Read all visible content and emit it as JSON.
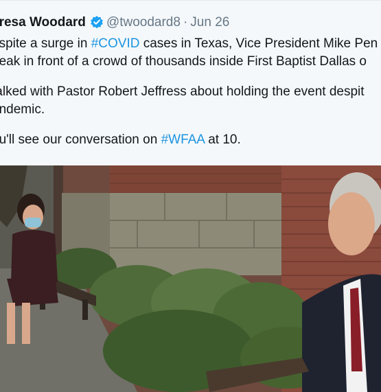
{
  "tweet": {
    "author_name": "eresa Woodard",
    "handle": "@twoodard8",
    "separator": "·",
    "date": "Jun 26",
    "lines": [
      {
        "pre": "espite a surge in ",
        "tag": "#COVID",
        "post": " cases in Texas, Vice President Mike Pen"
      },
      {
        "pre": "peak in front of a crowd of thousands inside First Baptist Dallas o",
        "tag": "",
        "post": ""
      },
      {
        "pre": "talked with Pastor Robert Jeffress about holding the event despit",
        "tag": "",
        "post": ""
      },
      {
        "pre": "andemic.",
        "tag": "",
        "post": ""
      },
      {
        "pre": "ou'll see our conversation on ",
        "tag": "#WFAA",
        "post": " at 10."
      }
    ]
  },
  "media": {
    "icons": [
      "verified-badge-icon"
    ],
    "colors": {
      "link": "#1b95e0",
      "verified": "#1da1f2",
      "brick": "#8a4a3c",
      "stone": "#8d8a78",
      "foliage": "#4f6b3a"
    }
  }
}
